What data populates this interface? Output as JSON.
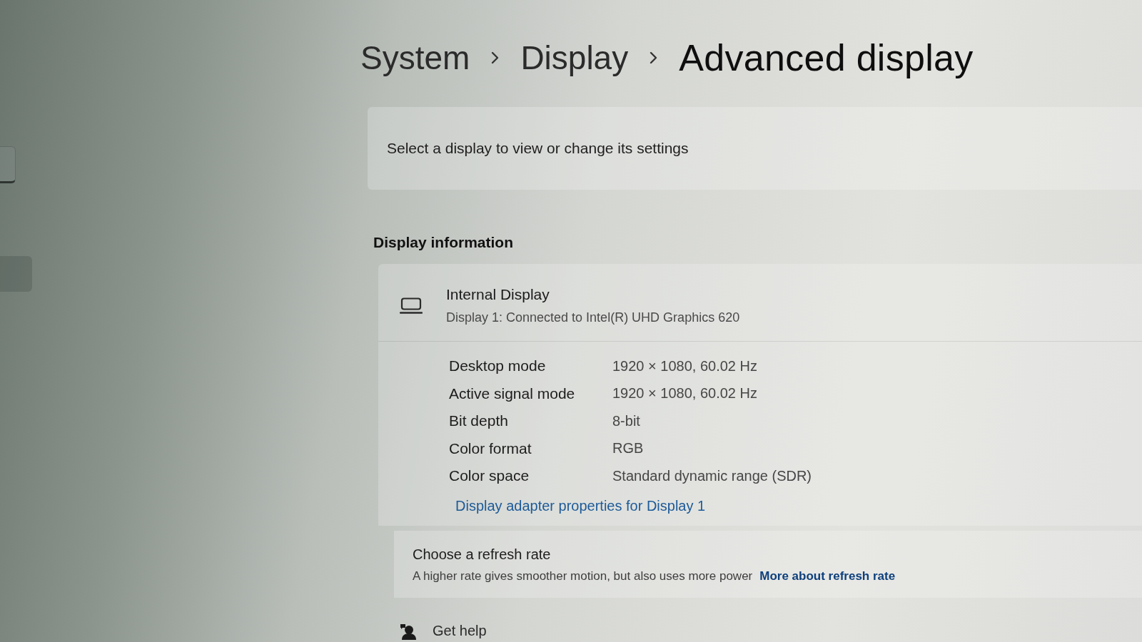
{
  "breadcrumb": [
    {
      "label": "System",
      "current": false
    },
    {
      "label": "Display",
      "current": false
    },
    {
      "label": "Advanced display",
      "current": true
    }
  ],
  "display_select": {
    "label": "Select a display to view or change its settings"
  },
  "display_information": {
    "heading": "Display information",
    "display": {
      "name": "Internal Display",
      "description": "Display 1: Connected to Intel(R) UHD Graphics 620"
    },
    "properties": [
      {
        "label": "Desktop mode",
        "value": "1920 × 1080, 60.02 Hz"
      },
      {
        "label": "Active signal mode",
        "value": "1920 × 1080, 60.02 Hz"
      },
      {
        "label": "Bit depth",
        "value": "8-bit"
      },
      {
        "label": "Color format",
        "value": "RGB"
      },
      {
        "label": "Color space",
        "value": "Standard dynamic range (SDR)"
      }
    ],
    "link": "Display adapter properties for Display 1"
  },
  "refresh_rate": {
    "title": "Choose a refresh rate",
    "description": "A higher rate gives smoother motion, but also uses more power",
    "link": "More about refresh rate"
  },
  "get_help": "Get help"
}
